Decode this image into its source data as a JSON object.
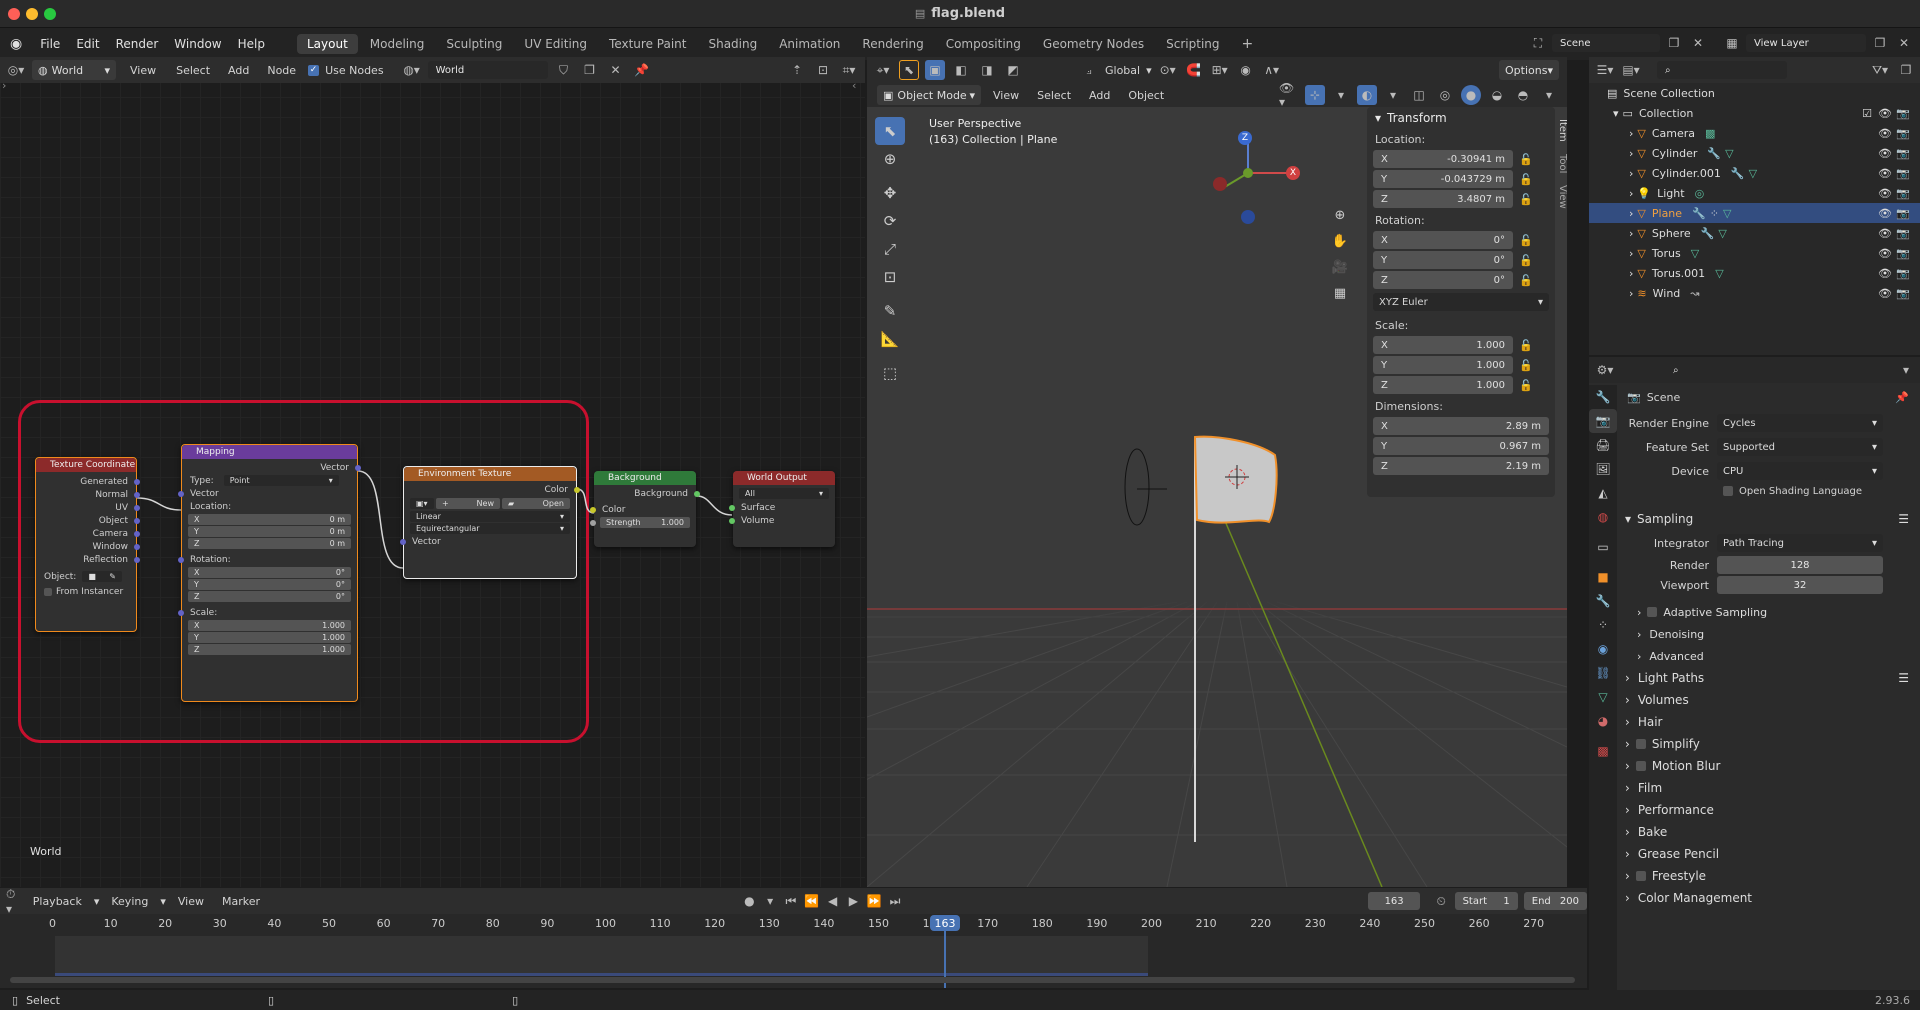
{
  "window": {
    "title": "flag.blend"
  },
  "menu": [
    "File",
    "Edit",
    "Render",
    "Window",
    "Help"
  ],
  "workspaces": [
    "Layout",
    "Modeling",
    "Sculpting",
    "UV Editing",
    "Texture Paint",
    "Shading",
    "Animation",
    "Rendering",
    "Compositing",
    "Geometry Nodes",
    "Scripting"
  ],
  "scene": "Scene",
  "view_layer": "View Layer",
  "node_editor": {
    "type": "World",
    "menus": [
      "View",
      "Select",
      "Add",
      "Node"
    ],
    "use_nodes": "Use Nodes",
    "world_name": "World",
    "corner_label": "World"
  },
  "nodes": {
    "texcoord": {
      "title": "Texture Coordinate",
      "outputs": [
        "Generated",
        "Normal",
        "UV",
        "Object",
        "Camera",
        "Window",
        "Reflection"
      ],
      "object_label": "Object:",
      "from_instancer": "From Instancer"
    },
    "mapping": {
      "title": "Mapping",
      "out": "Vector",
      "type_label": "Type:",
      "type": "Point",
      "vector": "Vector",
      "location": "Location:",
      "rotation": "Rotation:",
      "scale": "Scale:",
      "loc": [
        "0 m",
        "0 m",
        "0 m"
      ],
      "rot": [
        "0°",
        "0°",
        "0°"
      ],
      "scl": [
        "1.000",
        "1.000",
        "1.000"
      ],
      "axes": [
        "X",
        "Y",
        "Z"
      ]
    },
    "env": {
      "title": "Environment Texture",
      "out": "Color",
      "new": "New",
      "open": "Open",
      "interp": "Linear",
      "proj": "Equirectangular",
      "in": "Vector"
    },
    "bg": {
      "title": "Background",
      "out": "Background",
      "color": "Color",
      "strength_label": "Strength",
      "strength": "1.000"
    },
    "wo": {
      "title": "World Output",
      "target": "All",
      "surface": "Surface",
      "volume": "Volume"
    }
  },
  "viewport": {
    "mode": "Object Mode",
    "menus": [
      "View",
      "Select",
      "Add",
      "Object"
    ],
    "orientation": "Global",
    "options": "Options",
    "persp": "User Perspective",
    "info": "(163) Collection | Plane",
    "gizmo": [
      "Z",
      "X"
    ],
    "side_tabs": [
      "Item",
      "Tool",
      "View"
    ]
  },
  "transform": {
    "title": "Transform",
    "location_label": "Location:",
    "rotation_label": "Rotation:",
    "scale_label": "Scale:",
    "dimensions_label": "Dimensions:",
    "axes": [
      "X",
      "Y",
      "Z"
    ],
    "location": [
      "-0.30941 m",
      "-0.043729 m",
      "3.4807 m"
    ],
    "rotation": [
      "0°",
      "0°",
      "0°"
    ],
    "rot_mode": "XYZ Euler",
    "scale": [
      "1.000",
      "1.000",
      "1.000"
    ],
    "dimensions": [
      "2.89 m",
      "0.967 m",
      "2.19 m"
    ]
  },
  "outliner": {
    "root": "Scene Collection",
    "collection": "Collection",
    "items": [
      "Camera",
      "Cylinder",
      "Cylinder.001",
      "Light",
      "Plane",
      "Sphere",
      "Torus",
      "Torus.001",
      "Wind"
    ]
  },
  "properties": {
    "scene": "Scene",
    "render_engine_label": "Render Engine",
    "render_engine": "Cycles",
    "feature_set_label": "Feature Set",
    "feature_set": "Supported",
    "device_label": "Device",
    "device": "CPU",
    "osl": "Open Shading Language",
    "sampling": "Sampling",
    "integrator_label": "Integrator",
    "integrator": "Path Tracing",
    "render_label": "Render",
    "render": "128",
    "viewport_label": "Viewport",
    "viewport": "32",
    "sub": [
      "Adaptive Sampling",
      "Denoising",
      "Advanced"
    ],
    "panels": [
      "Light Paths",
      "Volumes",
      "Hair",
      "Simplify",
      "Motion Blur",
      "Film",
      "Performance",
      "Bake",
      "Grease Pencil",
      "Freestyle",
      "Color Management"
    ]
  },
  "timeline": {
    "menus": [
      "Playback",
      "Keying",
      "View",
      "Marker"
    ],
    "frame": "163",
    "start_label": "Start",
    "start": "1",
    "end_label": "End",
    "end": "200",
    "ruler": [
      "0",
      "10",
      "20",
      "30",
      "40",
      "50",
      "60",
      "70",
      "80",
      "90",
      "100",
      "110",
      "120",
      "130",
      "140",
      "150",
      "16",
      "170",
      "180",
      "190",
      "200",
      "210",
      "220",
      "230",
      "240",
      "250",
      "260",
      "270"
    ],
    "current": "163"
  },
  "status": {
    "left": "Select",
    "version": "2.93.6"
  },
  "colors": {
    "accent": "#4772b3",
    "selection_box": "#c8102e",
    "orange": "#f0902a"
  }
}
